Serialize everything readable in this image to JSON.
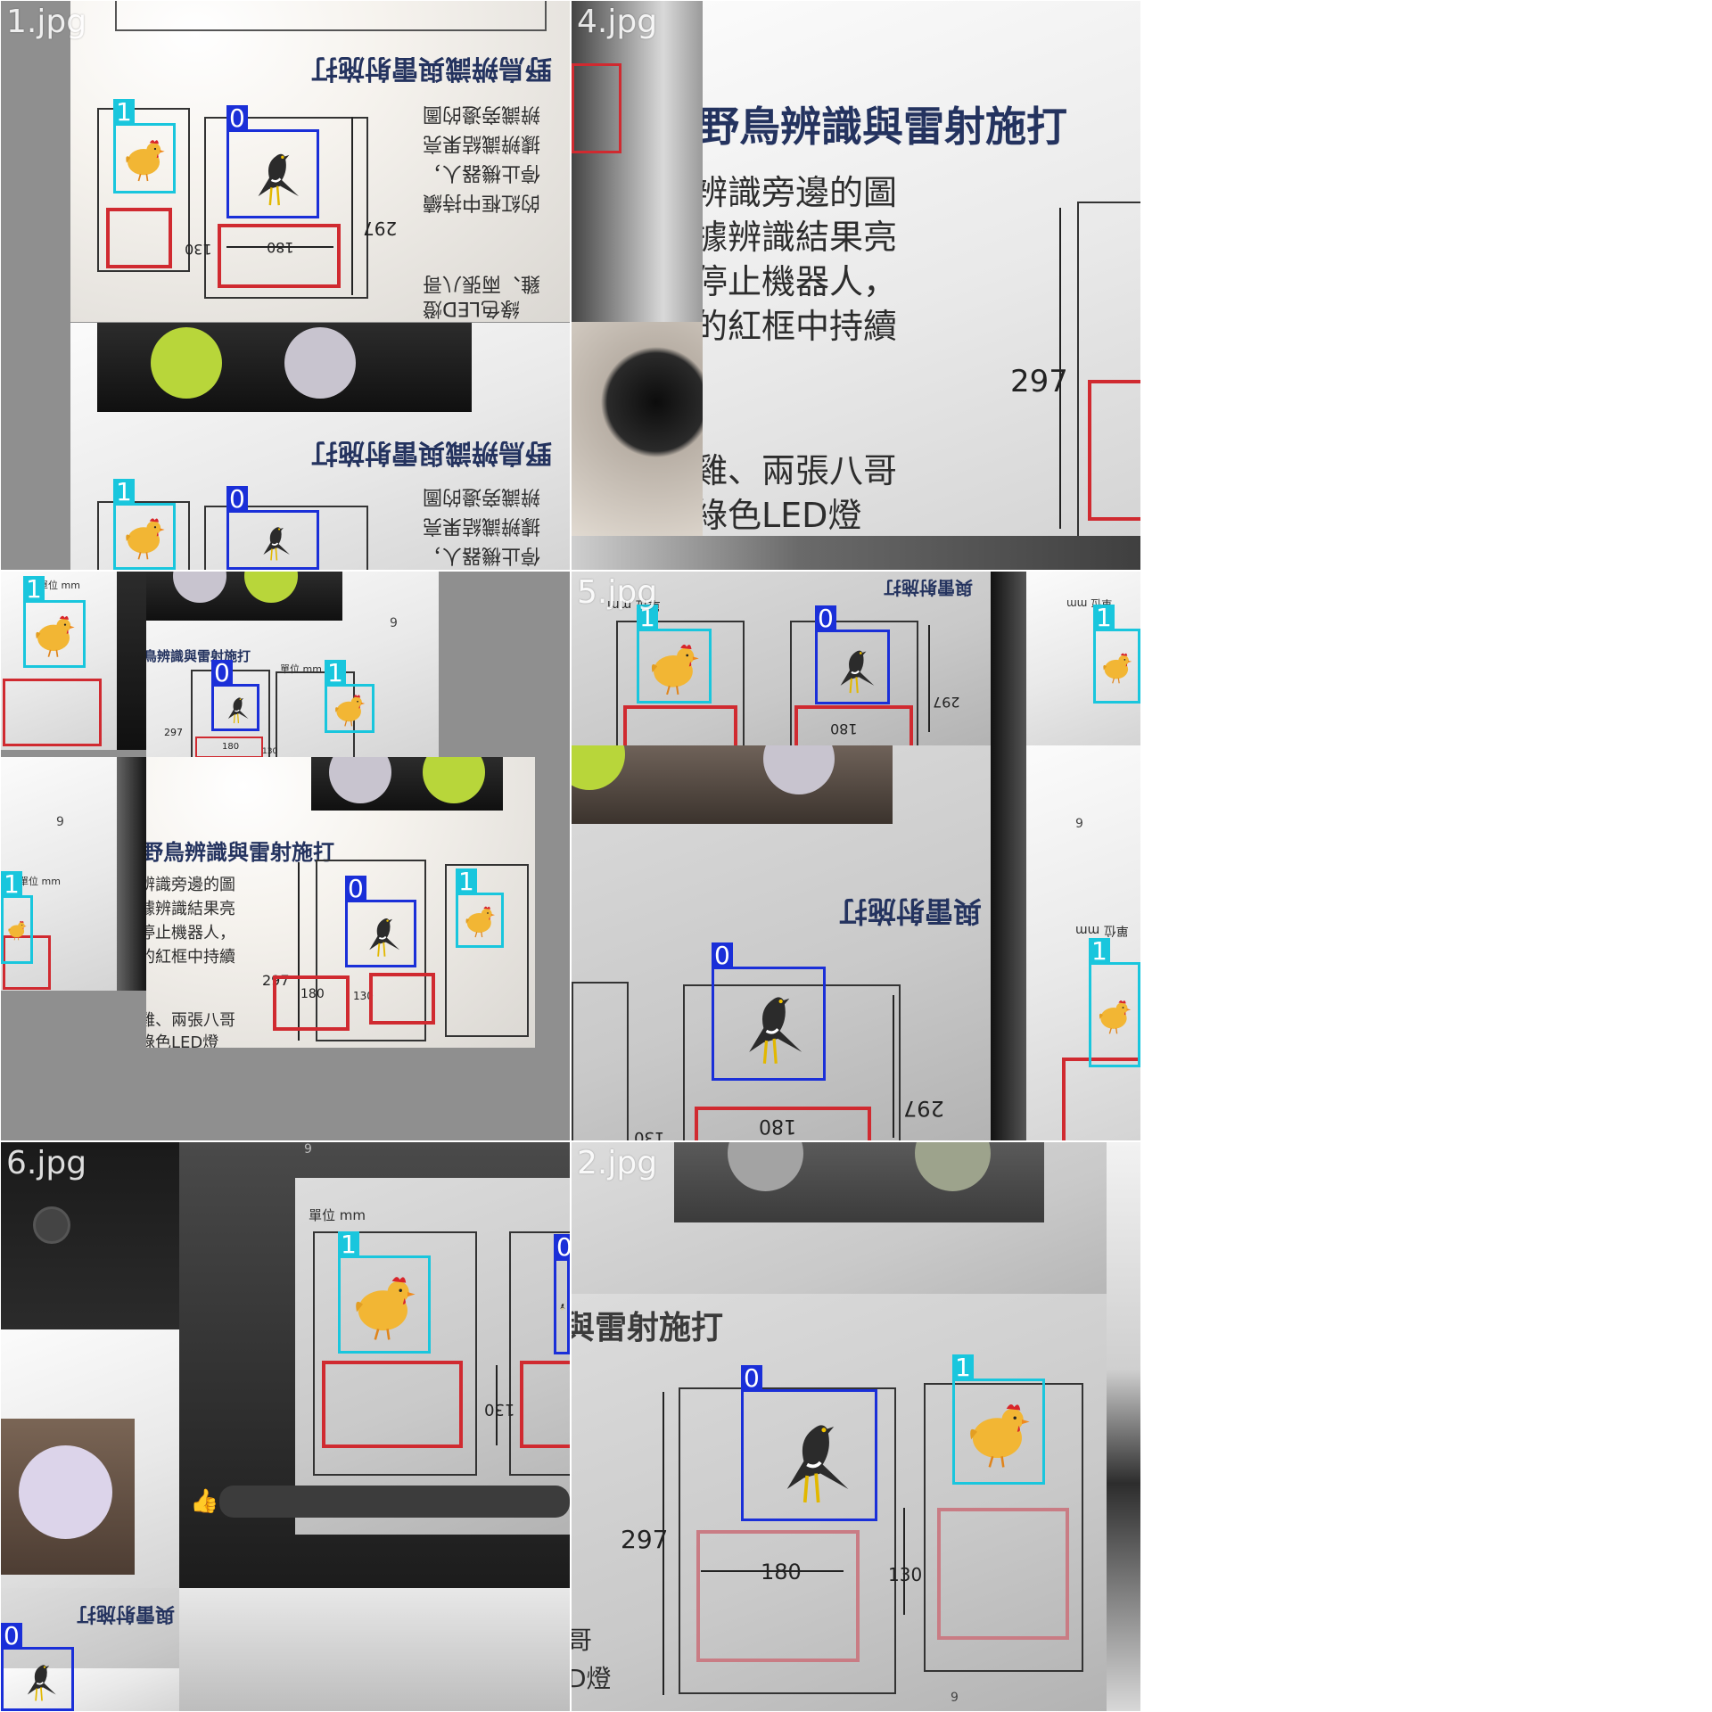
{
  "grid": {
    "tiles": [
      {
        "name": "1.jpg",
        "heading": "野鳥辨識與雷射施打",
        "body": [
          "辨識旁邊的圖",
          "據辨識結果亮",
          "停止機器人，",
          "的紅框中持續"
        ],
        "footer": [
          "雞、兩張八哥",
          "綠色LED燈"
        ],
        "dims": {
          "height": "297",
          "width": "180",
          "red": "130"
        },
        "detections": [
          {
            "label": "1",
            "kind": "hen"
          },
          {
            "label": "0",
            "kind": "myna"
          },
          {
            "label": "1",
            "kind": "hen"
          },
          {
            "label": "0",
            "kind": "myna"
          }
        ]
      },
      {
        "name": "4.jpg",
        "heading": "野鳥辨識與雷射施打",
        "body": [
          "辨識旁邊的圖",
          "據辨識結果亮",
          "停止機器人，",
          "的紅框中持續"
        ],
        "footer": [
          "雞、兩張八哥",
          "綠色LED燈"
        ],
        "dims": {
          "height": "297"
        },
        "detections": []
      },
      {
        "name": "",
        "unit": "單位 mm",
        "heading": "野鳥辨識與雷射施打",
        "body": [
          "辨識旁邊的圖",
          "據辨識結果亮",
          "停止機器人，",
          "的紅框中持續"
        ],
        "footer": [
          "雞、兩張八哥",
          "綠色LED燈"
        ],
        "dims": {
          "height": "297",
          "width": "180",
          "red": "130"
        },
        "page": "9",
        "detections": [
          {
            "label": "1",
            "kind": "hen"
          },
          {
            "label": "0",
            "kind": "myna"
          },
          {
            "label": "1",
            "kind": "hen"
          },
          {
            "label": "1",
            "kind": "hen"
          },
          {
            "label": "0",
            "kind": "myna"
          },
          {
            "label": "1",
            "kind": "hen"
          }
        ]
      },
      {
        "name": "5.jpg",
        "unit": "單位 mm",
        "heading": "與雷射施打",
        "dims": {
          "height": "297",
          "width": "180",
          "red": "130"
        },
        "page": "9",
        "detections": [
          {
            "label": "1",
            "kind": "hen"
          },
          {
            "label": "0",
            "kind": "myna"
          },
          {
            "label": "1",
            "kind": "hen"
          },
          {
            "label": "0",
            "kind": "myna"
          },
          {
            "label": "1",
            "kind": "hen"
          }
        ]
      },
      {
        "name": "6.jpg",
        "unit": "單位 mm",
        "heading": "與雷射施打",
        "dims": {
          "red": "130"
        },
        "page": "9",
        "detections": [
          {
            "label": "1",
            "kind": "hen"
          },
          {
            "label": "0",
            "kind": "myna"
          },
          {
            "label": "0",
            "kind": "myna"
          }
        ]
      },
      {
        "name": "2.jpg",
        "heading": "與雷射施打",
        "footer": [
          "哥",
          "D燈"
        ],
        "dims": {
          "height": "297",
          "width": "180",
          "red": "130"
        },
        "page": "9",
        "detections": [
          {
            "label": "0",
            "kind": "myna"
          },
          {
            "label": "1",
            "kind": "hen"
          }
        ]
      }
    ]
  },
  "colors": {
    "class_0": "#1a2fd8",
    "class_1": "#19c6dd",
    "red_frame": "#d02a30",
    "background": "#8f8f8f"
  },
  "icons": {
    "like": "thumbs-up-icon",
    "emoji": "emoji-icon"
  }
}
